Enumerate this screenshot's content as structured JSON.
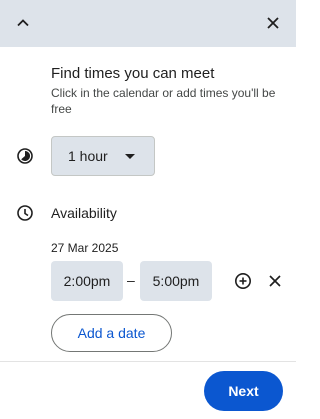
{
  "header": {
    "collapse_icon": "chevron-up-icon",
    "close_icon": "close-icon",
    "background": "#dde3ea"
  },
  "intro": {
    "title": "Find times you can meet",
    "subtitle": "Click in the calendar or add times you'll be free"
  },
  "duration": {
    "icon": "timer-icon",
    "selected": "1 hour"
  },
  "availability": {
    "icon": "clock-icon",
    "label": "Availability",
    "date": "27 Mar 2025",
    "start_time": "2:00pm",
    "separator": "–",
    "end_time": "5:00pm",
    "add_icon": "add-circle-icon",
    "remove_icon": "close-icon",
    "add_date_label": "Add a date"
  },
  "footer": {
    "next_label": "Next",
    "accent": "#0b57d0"
  }
}
